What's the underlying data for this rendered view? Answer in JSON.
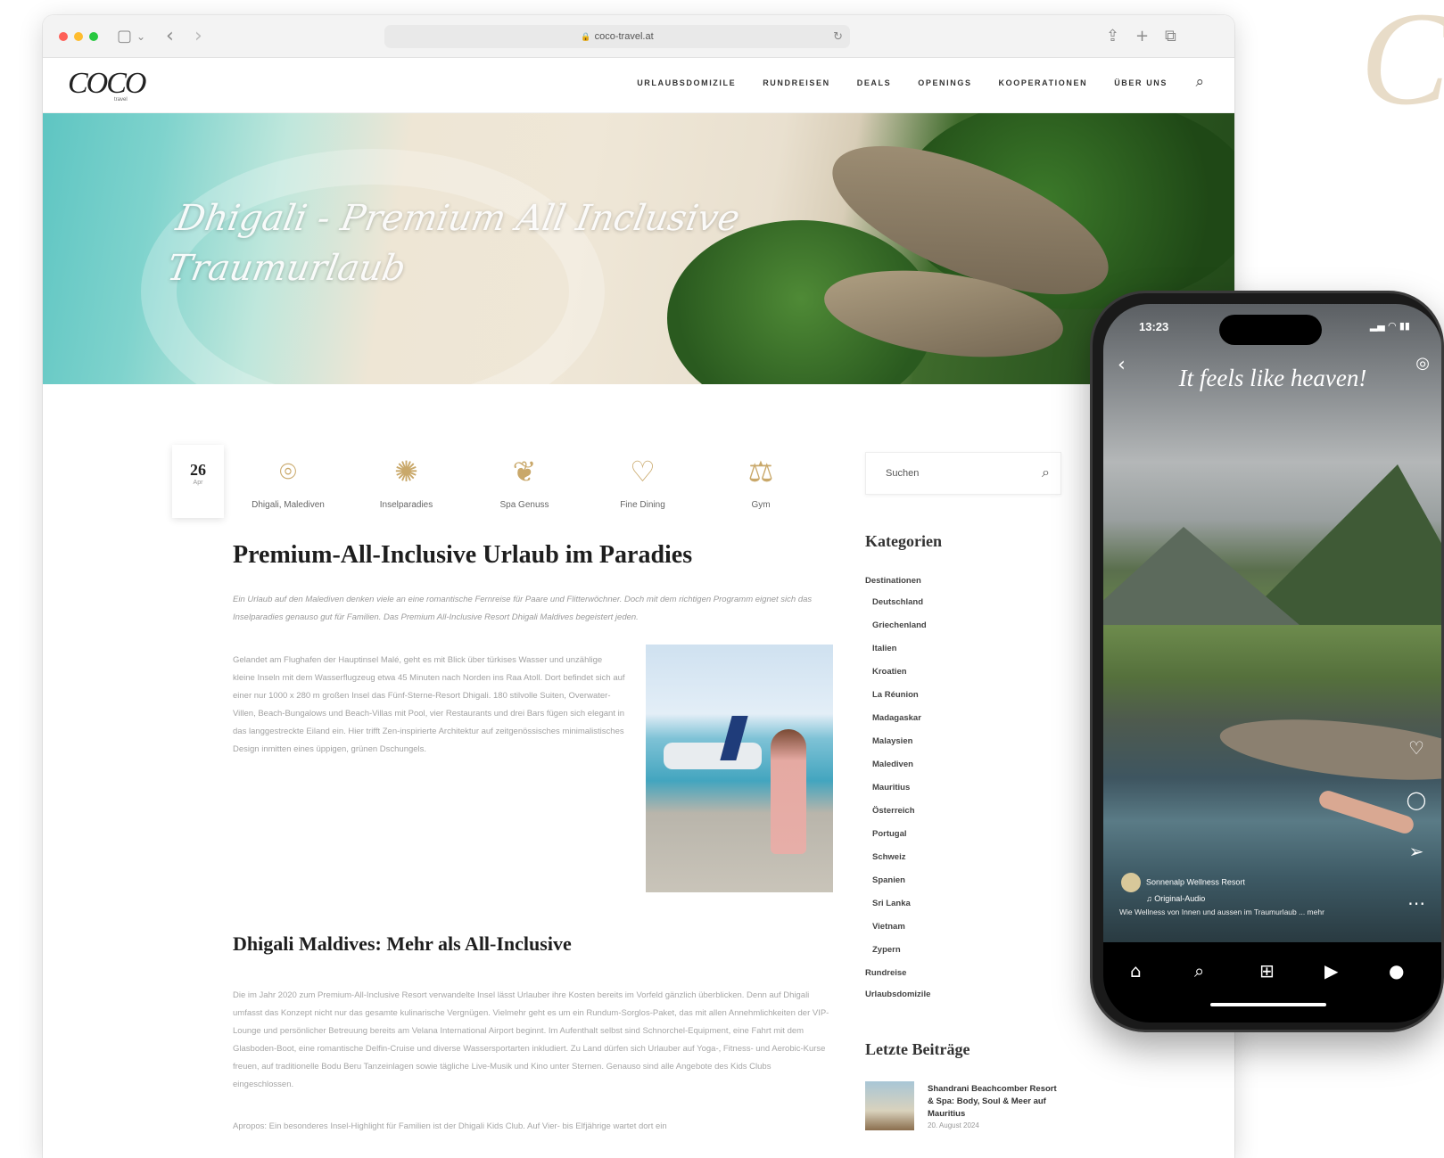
{
  "decor_logo": "Co",
  "browser": {
    "url": "coco-travel.at",
    "controls": {
      "sidebar_icon": "▢",
      "chevron": "⌄",
      "back_icon": "‹",
      "forward_icon": "›",
      "reload_icon": "↻",
      "share_icon": "⇪",
      "new_tab_icon": "+",
      "tabs_icon": "⧉"
    }
  },
  "site": {
    "logo": "COCO",
    "logo_sub": "travel",
    "nav": [
      "URLAUBSDOMIZILE",
      "RUNDREISEN",
      "DEALS",
      "OPENINGS",
      "KOOPERATIONEN",
      "ÜBER UNS"
    ],
    "search_icon": "⌕"
  },
  "hero": {
    "title": "Dhigali - Premium All Inclusive Traumurlaub"
  },
  "post": {
    "date_day": "26",
    "date_month": "Apr",
    "features": [
      {
        "icon": "location-pin-icon",
        "glyph": "⌾",
        "label": "Dhigali, Malediven"
      },
      {
        "icon": "island-icon",
        "glyph": "✺",
        "label": "Inselparadies"
      },
      {
        "icon": "lotus-icon",
        "glyph": "❦",
        "label": "Spa Genuss"
      },
      {
        "icon": "heart-dining-icon",
        "glyph": "♡",
        "label": "Fine Dining"
      },
      {
        "icon": "gym-icon",
        "glyph": "⚖",
        "label": "Gym"
      }
    ],
    "title": "Premium-All-Inclusive Urlaub im Paradies",
    "intro": "Ein Urlaub auf den Malediven denken viele an eine romantische Fernreise für Paare und Flitterwöchner. Doch mit dem richtigen Programm eignet sich das Inselparadies genauso gut für Familien. Das Premium All-Inclusive Resort Dhigali Maldives begeistert jeden.",
    "body1": "Gelandet am Flughafen der Hauptinsel Malé, geht es mit Blick über türkises Wasser und unzählige kleine Inseln mit dem Wasserflugzeug etwa 45 Minuten nach Norden ins Raa Atoll. Dort befindet sich auf einer nur 1000 x 280 m großen Insel das Fünf-Sterne-Resort Dhigali. 180 stilvolle Suiten, Overwater-Villen, Beach-Bungalows und Beach-Villas mit Pool, vier Restaurants und drei Bars fügen sich elegant in das langgestreckte Eiland ein. Hier trifft Zen-inspirierte Architektur auf zeitgenössisches minimalistisches Design inmitten eines üppigen, grünen Dschungels.",
    "h2": "Dhigali Maldives: Mehr als All-Inclusive",
    "body2": "Die im Jahr 2020 zum Premium-All-Inclusive Resort verwandelte Insel lässt Urlauber ihre Kosten bereits im Vorfeld gänzlich überblicken. Denn auf Dhigali umfasst das Konzept nicht nur das gesamte kulinarische Vergnügen. Vielmehr geht es um ein Rundum-Sorglos-Paket, das mit allen Annehmlichkeiten der VIP-Lounge und persönlicher Betreuung bereits am Velana International Airport beginnt. Im Aufenthalt selbst sind Schnorchel-Equipment, eine Fahrt mit dem Glasboden-Boot, eine romantische Delfin-Cruise und diverse Wassersportarten inkludiert. Zu Land dürfen sich Urlauber auf Yoga-, Fitness- und Aerobic-Kurse freuen, auf traditionelle Bodu Beru Tanzeinlagen sowie tägliche Live-Musik und Kino unter Sternen. Genauso sind alle Angebote des Kids Clubs eingeschlossen.",
    "body3": "Apropos: Ein besonderes Insel-Highlight für Familien ist der Dhigali Kids Club. Auf Vier- bis Elfjährige wartet dort ein"
  },
  "sidebar": {
    "search_placeholder": "Suchen",
    "search_icon": "⌕",
    "categories_heading": "Kategorien",
    "categories": [
      {
        "label": "Destinationen",
        "sub": false
      },
      {
        "label": "Deutschland",
        "sub": true
      },
      {
        "label": "Griechenland",
        "sub": true
      },
      {
        "label": "Italien",
        "sub": true
      },
      {
        "label": "Kroatien",
        "sub": true
      },
      {
        "label": "La Réunion",
        "sub": true
      },
      {
        "label": "Madagaskar",
        "sub": true
      },
      {
        "label": "Malaysien",
        "sub": true
      },
      {
        "label": "Malediven",
        "sub": true
      },
      {
        "label": "Mauritius",
        "sub": true
      },
      {
        "label": "Österreich",
        "sub": true
      },
      {
        "label": "Portugal",
        "sub": true
      },
      {
        "label": "Schweiz",
        "sub": true
      },
      {
        "label": "Spanien",
        "sub": true
      },
      {
        "label": "Sri Lanka",
        "sub": true
      },
      {
        "label": "Vietnam",
        "sub": true
      },
      {
        "label": "Zypern",
        "sub": true
      },
      {
        "label": "Rundreise",
        "sub": false
      },
      {
        "label": "Urlaubsdomizile",
        "sub": false
      }
    ],
    "recent_heading": "Letzte Beiträge",
    "recent_title": "Shandrani Beachcomber Resort & Spa: Body, Soul & Meer auf Mauritius",
    "recent_date": "20. August 2024"
  },
  "phone": {
    "time": "13:23",
    "status_icons": "▂▄ ◠ ▮▮",
    "back_icon": "‹",
    "camera_icon": "◎",
    "caption": "It feels like heaven!",
    "actions": [
      "♡",
      "◯",
      "➢",
      "⋯"
    ],
    "username": "Sonnenalp Wellness Resort",
    "user_sub": "♫ Original-Audio",
    "description": "Wie Wellness von Innen und aussen im Traumurlaub ... mehr",
    "nav_icons": [
      "⌂",
      "⌕",
      "⊞",
      "▶",
      "●"
    ]
  }
}
